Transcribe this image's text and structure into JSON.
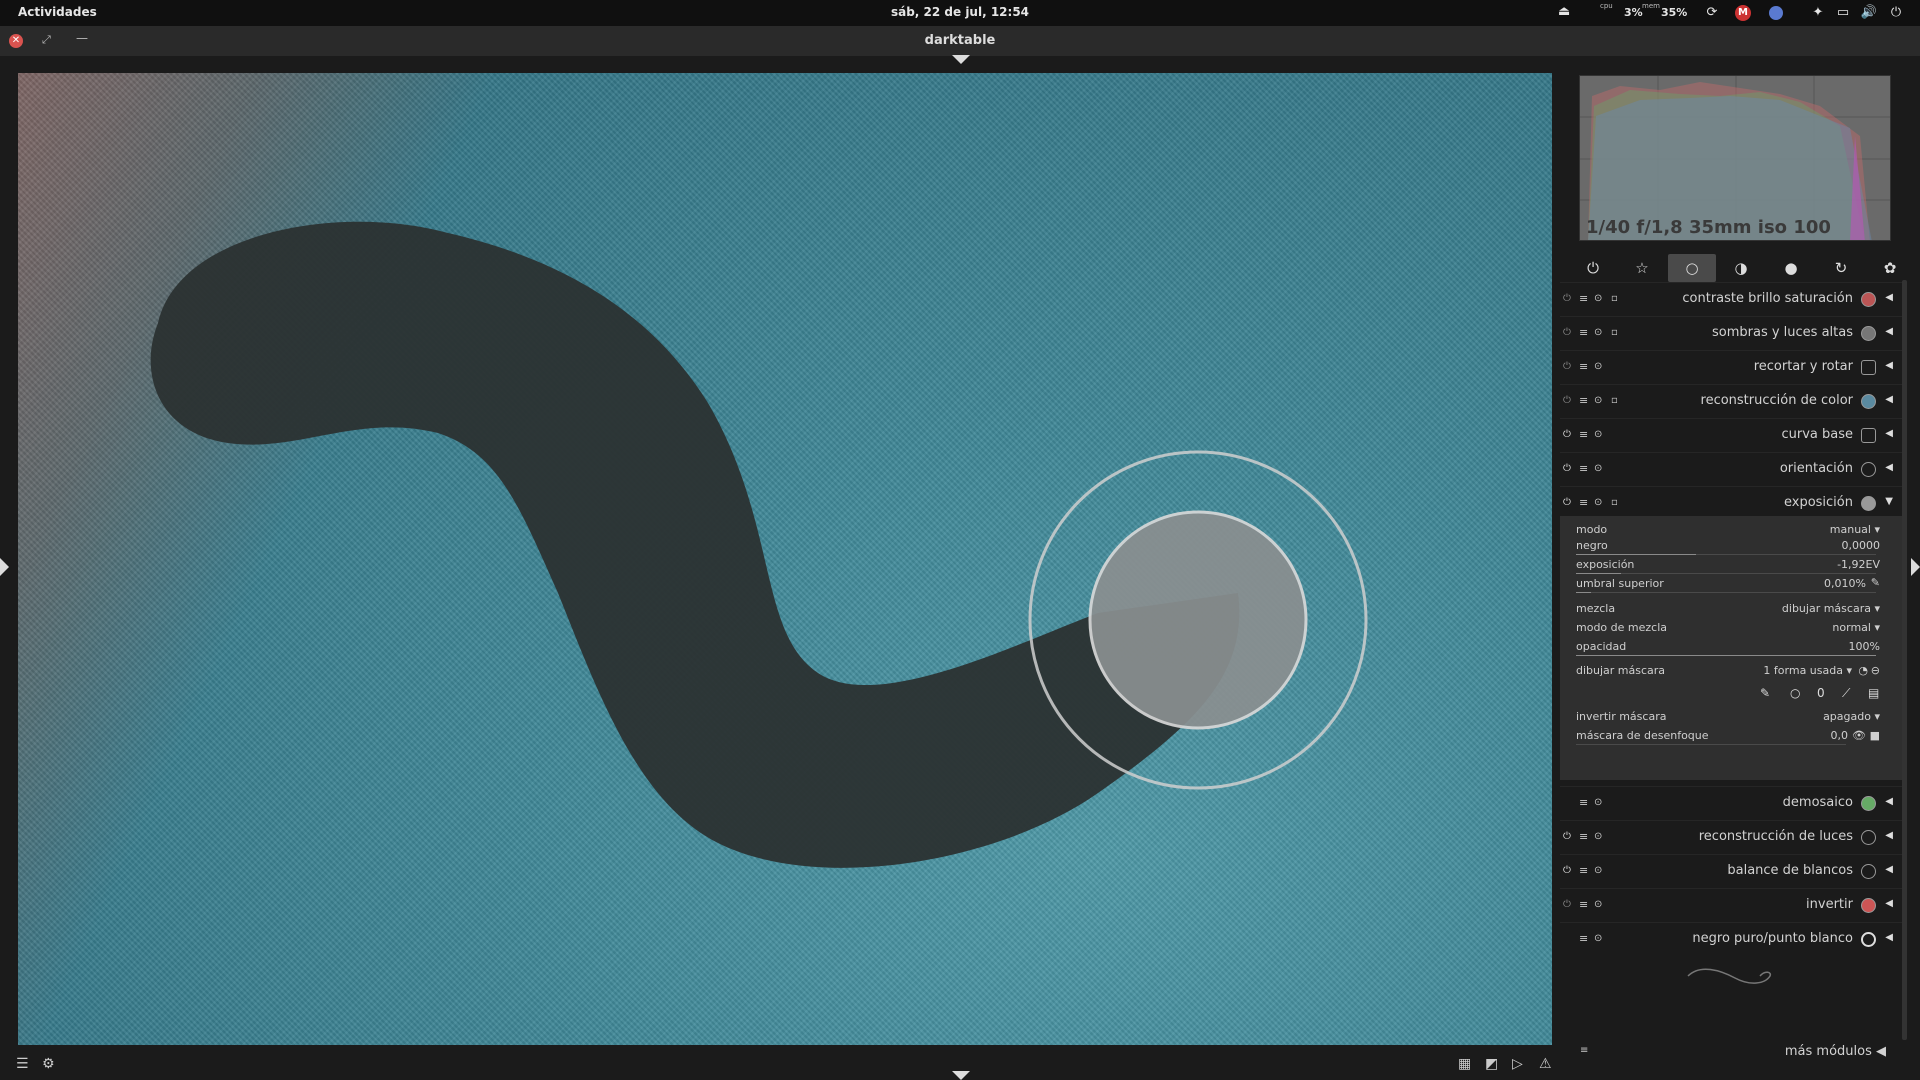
{
  "topbar": {
    "activities": "Actividades",
    "clock": "sáb, 22 de jul, 12:54",
    "cpu_label": "cpu",
    "cpu_value": "3%",
    "mem_label": "mem",
    "mem_value": "35%",
    "gmail_badge": "M"
  },
  "window": {
    "title": "darktable"
  },
  "histogram": {
    "exif": "1/40 f/1,8 35mm iso 100"
  },
  "module_groups": [
    "power-icon",
    "star-icon",
    "circle-icon",
    "half-circle-icon",
    "color-icon",
    "correct-icon",
    "effect-icon"
  ],
  "modules_top": [
    {
      "name": "contraste brillo saturación",
      "enabled": false,
      "mask": true
    },
    {
      "name": "sombras y luces altas",
      "enabled": false,
      "mask": true
    },
    {
      "name": "recortar y rotar",
      "enabled": false,
      "mask": false
    },
    {
      "name": "reconstrucción de color",
      "enabled": false,
      "mask": true
    },
    {
      "name": "curva base",
      "enabled": true,
      "mask": false
    },
    {
      "name": "orientación",
      "enabled": true,
      "mask": false
    },
    {
      "name": "exposición",
      "enabled": true,
      "mask": true
    }
  ],
  "exposure": {
    "modo_label": "modo",
    "modo_value": "manual",
    "negro_label": "negro",
    "negro_value": "0,0000",
    "exposicion_label": "exposición",
    "exposicion_value": "-1,92EV",
    "umbral_label": "umbral superior",
    "umbral_value": "0,010%",
    "mezcla_label": "mezcla",
    "mezcla_value": "dibujar máscara",
    "modo_mezcla_label": "modo de mezcla",
    "modo_mezcla_value": "normal",
    "opacidad_label": "opacidad",
    "opacidad_value": "100%",
    "dibujar_label": "dibujar máscara",
    "dibujar_value": "1 forma usada",
    "invertir_label": "invertir máscara",
    "invertir_value": "apagado",
    "desenfoque_label": "máscara de desenfoque",
    "desenfoque_value": "0,0"
  },
  "modules_bottom": [
    {
      "name": "demosaico",
      "enabled": null
    },
    {
      "name": "reconstrucción de luces",
      "enabled": true
    },
    {
      "name": "balance de blancos",
      "enabled": true
    },
    {
      "name": "invertir",
      "enabled": false
    },
    {
      "name": "negro puro/punto blanco",
      "enabled": null
    }
  ],
  "more_modules": "más módulos",
  "colors": {
    "accent_red": "#d9534f",
    "panel_bg": "#2f2f2f",
    "mask_dark": "#2b3232"
  }
}
